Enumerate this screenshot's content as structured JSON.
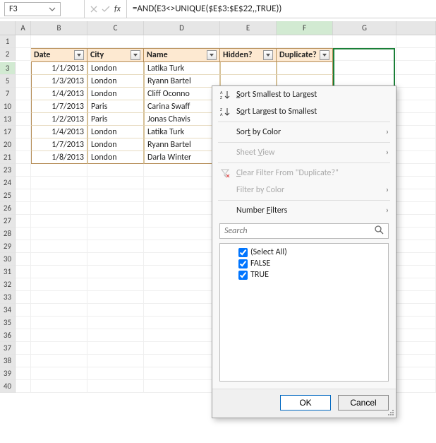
{
  "namebox": {
    "value": "F3"
  },
  "fx_label": "fx",
  "formula": "=AND(E3<>UNIQUE($E$3:$E$22,,TRUE))",
  "columns": [
    "",
    "A",
    "B",
    "C",
    "D",
    "E",
    "F",
    "G"
  ],
  "active_col_index": 6,
  "row_numbers_pre": [
    1,
    2
  ],
  "row_numbers_data": [
    3,
    5,
    7,
    10,
    13,
    17,
    20,
    21
  ],
  "row_numbers_post": [
    23,
    24,
    25,
    26,
    27,
    28,
    29,
    30,
    31,
    32,
    33,
    34,
    35,
    36,
    37,
    38,
    39,
    40
  ],
  "table": {
    "headers": [
      "Date",
      "City",
      "Name",
      "Hidden?",
      "Duplicate?"
    ],
    "rows": [
      {
        "date": "1/1/2013",
        "city": "London",
        "name": "Latika Turk"
      },
      {
        "date": "1/3/2013",
        "city": "London",
        "name": "Ryann Bartel"
      },
      {
        "date": "1/4/2013",
        "city": "London",
        "name": "Cliff Oconno"
      },
      {
        "date": "1/7/2013",
        "city": "Paris",
        "name": "Carina Swaff"
      },
      {
        "date": "1/2/2013",
        "city": "Paris",
        "name": "Jonas Chavis"
      },
      {
        "date": "1/4/2013",
        "city": "London",
        "name": "Latika Turk"
      },
      {
        "date": "1/7/2013",
        "city": "London",
        "name": "Ryann Bartel"
      },
      {
        "date": "1/8/2013",
        "city": "London",
        "name": "Darla Winter"
      }
    ]
  },
  "popup": {
    "sort_asc_pre": "S",
    "sort_asc": "ort Smallest to Largest",
    "sort_desc_pre": "S",
    "sort_desc_mid": "o",
    "sort_desc": "rt Largest to Smallest",
    "sort_color_pre": "Sor",
    "sort_color_mid": "t",
    "sort_color": " by Color",
    "sheet_view_pre": "Sheet ",
    "sheet_view_mid": "V",
    "sheet_view": "iew",
    "clear_filter_pre": "C",
    "clear_filter": "lear Filter From \"Duplicate?\"",
    "filter_color_label": "Filter by Color",
    "number_filters_pre": "Number ",
    "number_filters_mid": "F",
    "number_filters": "ilters",
    "search_placeholder": "Search",
    "tree": {
      "select_all": "(Select All)",
      "opt_false": "FALSE",
      "opt_true": "TRUE"
    },
    "ok": "OK",
    "cancel": "Cancel"
  }
}
